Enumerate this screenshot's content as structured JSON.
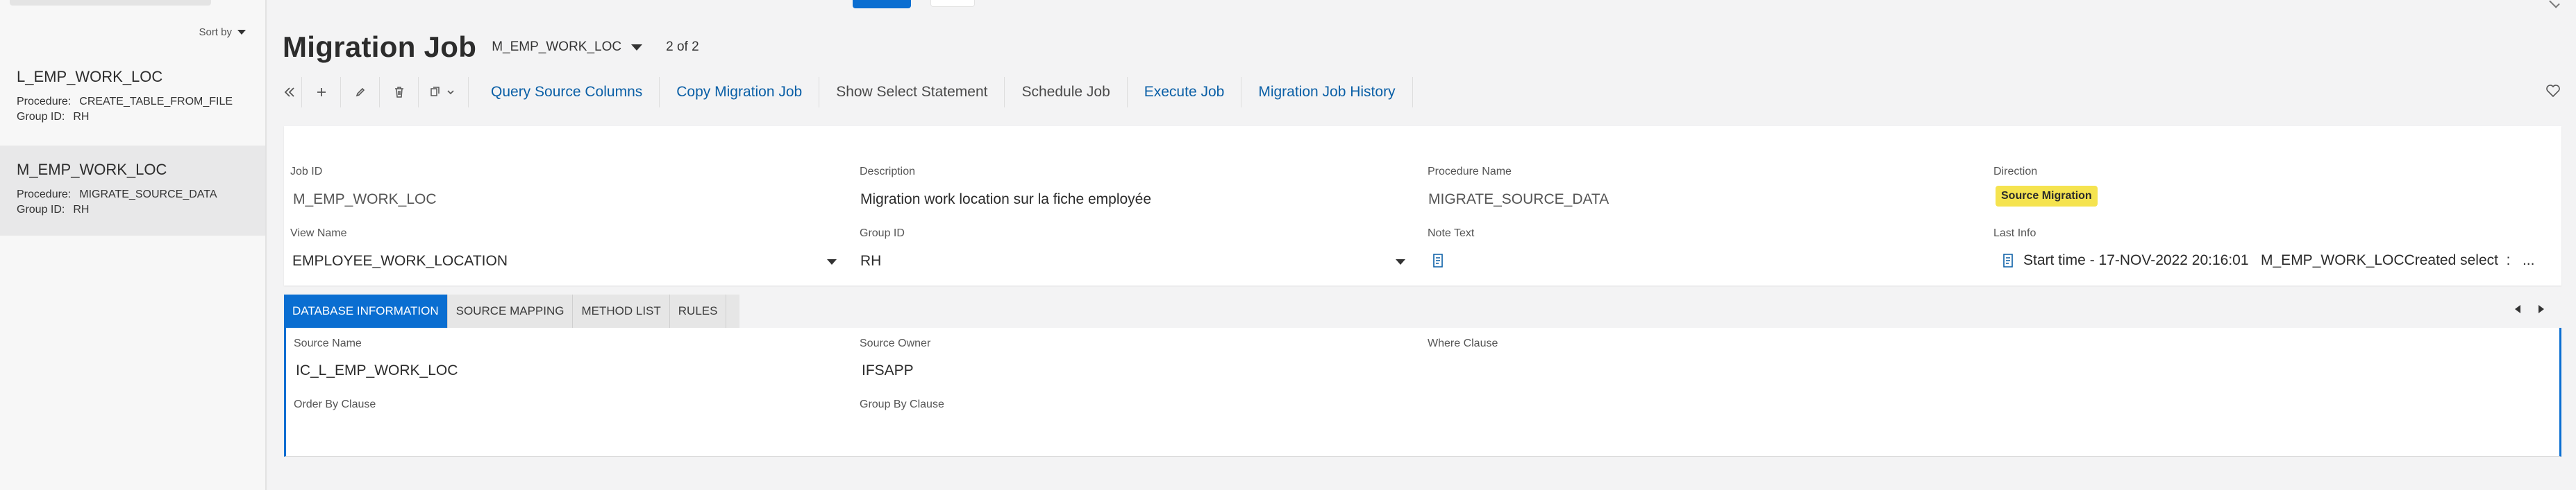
{
  "sort_by_label": "Sort by",
  "list": [
    {
      "title": "L_EMP_WORK_LOC",
      "procedure_label": "Procedure:",
      "procedure": "CREATE_TABLE_FROM_FILE",
      "group_label": "Group ID:",
      "group": "RH"
    },
    {
      "title": "M_EMP_WORK_LOC",
      "procedure_label": "Procedure:",
      "procedure": "MIGRATE_SOURCE_DATA",
      "group_label": "Group ID:",
      "group": "RH"
    }
  ],
  "header": {
    "title": "Migration Job",
    "record_select": "M_EMP_WORK_LOC",
    "record_count": "2 of 2"
  },
  "toolbar": {
    "icons": [
      "double-chevron-left-icon",
      "plus-icon",
      "pencil-icon",
      "trash-icon",
      "copy-dropdown-icon"
    ],
    "commands": [
      {
        "label": "Query Source Columns"
      },
      {
        "label": "Copy Migration Job"
      },
      {
        "label": "Show Select Statement"
      },
      {
        "label": "Schedule Job"
      },
      {
        "label": "Execute Job"
      },
      {
        "label": "Migration Job History"
      }
    ]
  },
  "form": {
    "job_id": {
      "label": "Job ID",
      "value": "M_EMP_WORK_LOC"
    },
    "description": {
      "label": "Description",
      "value": "Migration work location sur la fiche employée"
    },
    "procedure_name": {
      "label": "Procedure Name",
      "value": "MIGRATE_SOURCE_DATA"
    },
    "direction": {
      "label": "Direction",
      "value": "Source Migration"
    },
    "view_name": {
      "label": "View Name",
      "value": "EMPLOYEE_WORK_LOCATION"
    },
    "group_id": {
      "label": "Group ID",
      "value": "RH"
    },
    "note_text": {
      "label": "Note Text"
    },
    "last_info": {
      "label": "Last Info",
      "value": "Start time - 17-NOV-2022 20:16:01   M_EMP_WORK_LOCCreated select  :   ..."
    }
  },
  "tabs": [
    {
      "label": "DATABASE INFORMATION"
    },
    {
      "label": "SOURCE MAPPING"
    },
    {
      "label": "METHOD LIST"
    },
    {
      "label": "RULES"
    }
  ],
  "db_info": {
    "source_name": {
      "label": "Source Name",
      "value": "IC_L_EMP_WORK_LOC"
    },
    "source_owner": {
      "label": "Source Owner",
      "value": "IFSAPP"
    },
    "where_clause": {
      "label": "Where Clause"
    },
    "order_by_clause": {
      "label": "Order By Clause"
    },
    "group_by_clause": {
      "label": "Group By Clause"
    }
  },
  "colors": {
    "accent": "#0a6ed1",
    "link": "#0a5fa6",
    "badge": "#f5e34f"
  }
}
